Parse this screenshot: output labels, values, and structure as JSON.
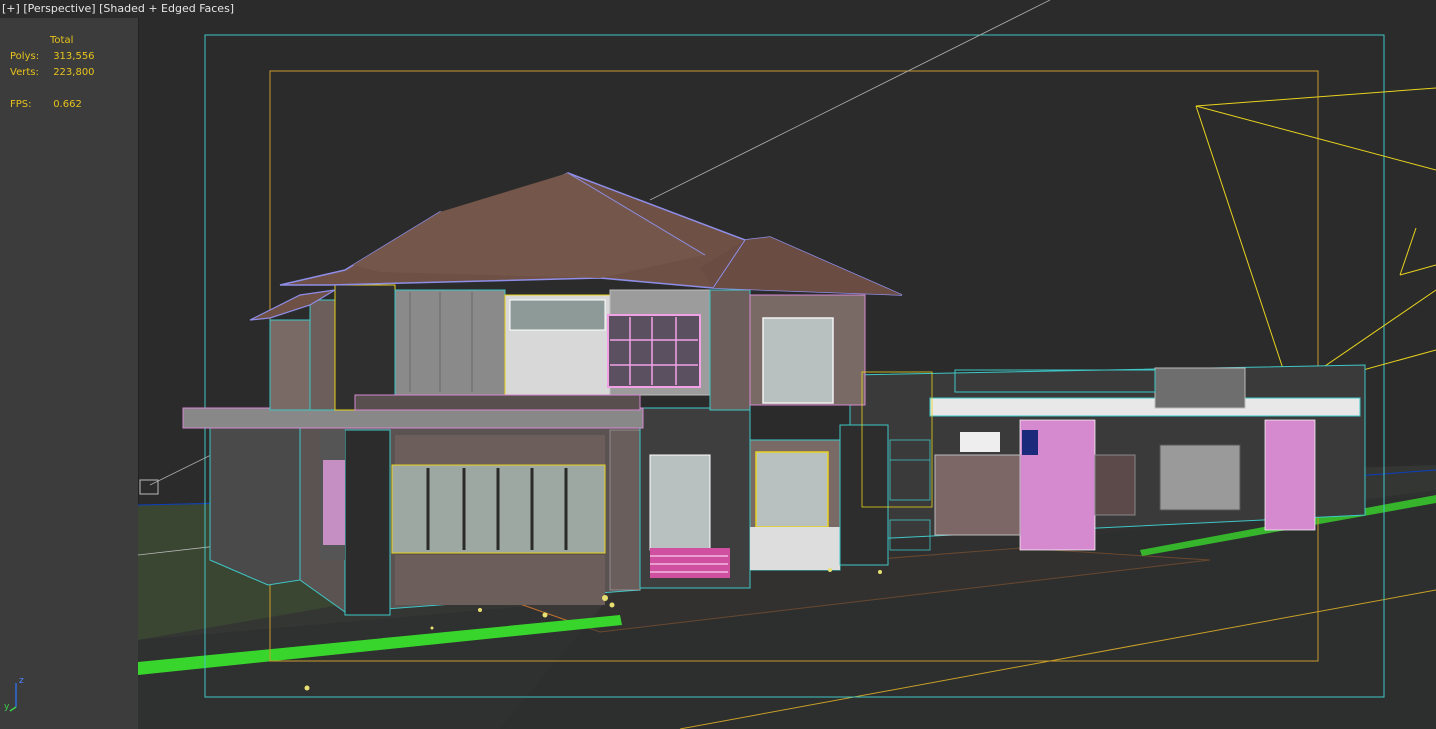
{
  "viewport": {
    "label_parts": [
      "[+]",
      "[Perspective]",
      "[Shaded + Edged Faces]"
    ]
  },
  "stats": {
    "header": "Total",
    "polys_label": "Polys:",
    "polys_value": "313,556",
    "verts_label": "Verts:",
    "verts_value": "223,800",
    "fps_label": "FPS:",
    "fps_value": "0.662"
  },
  "axis": {
    "z_label": "z",
    "y_label": "y"
  },
  "colors": {
    "background": "#2b2b2b",
    "stats_text": "#e8c31c",
    "safe_frame_outer": "#3fc6c6",
    "safe_frame_inner": "#c89a2e",
    "camera_lines": "#e8d21e",
    "grass_edge": "#38d62c",
    "roof": "#6f5045",
    "wall": "#6e5f5a"
  }
}
